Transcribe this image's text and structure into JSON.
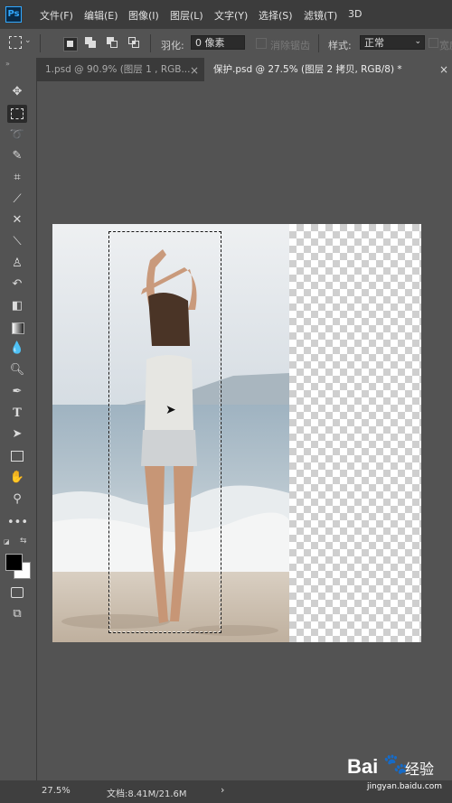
{
  "app": {
    "logo": "Ps"
  },
  "menu": [
    "文件(F)",
    "编辑(E)",
    "图像(I)",
    "图层(L)",
    "文字(Y)",
    "选择(S)",
    "滤镜(T)",
    "3D"
  ],
  "options": {
    "feather_label": "羽化:",
    "feather_value": "0 像素",
    "antialias_label": "消除锯齿",
    "style_label": "样式:",
    "style_value": "正常",
    "width_label": "宽度"
  },
  "tabs": [
    {
      "label": "1.psd @ 90.9% (图层 1 , RGB...",
      "active": false
    },
    {
      "label": "保护.psd @ 27.5% (图层 2 拷贝, RGB/8) *",
      "active": true
    }
  ],
  "status": {
    "zoom": "27.5%",
    "doc_info": "文档:8.41M/21.6M",
    "arrow": "›"
  },
  "watermark": {
    "brand": "Bai",
    "brand_suffix": "经验",
    "url": "jingyan.baidu.com"
  },
  "colors": {
    "foreground": "#000000",
    "background": "#ffffff",
    "accent": "#31a8ff"
  }
}
